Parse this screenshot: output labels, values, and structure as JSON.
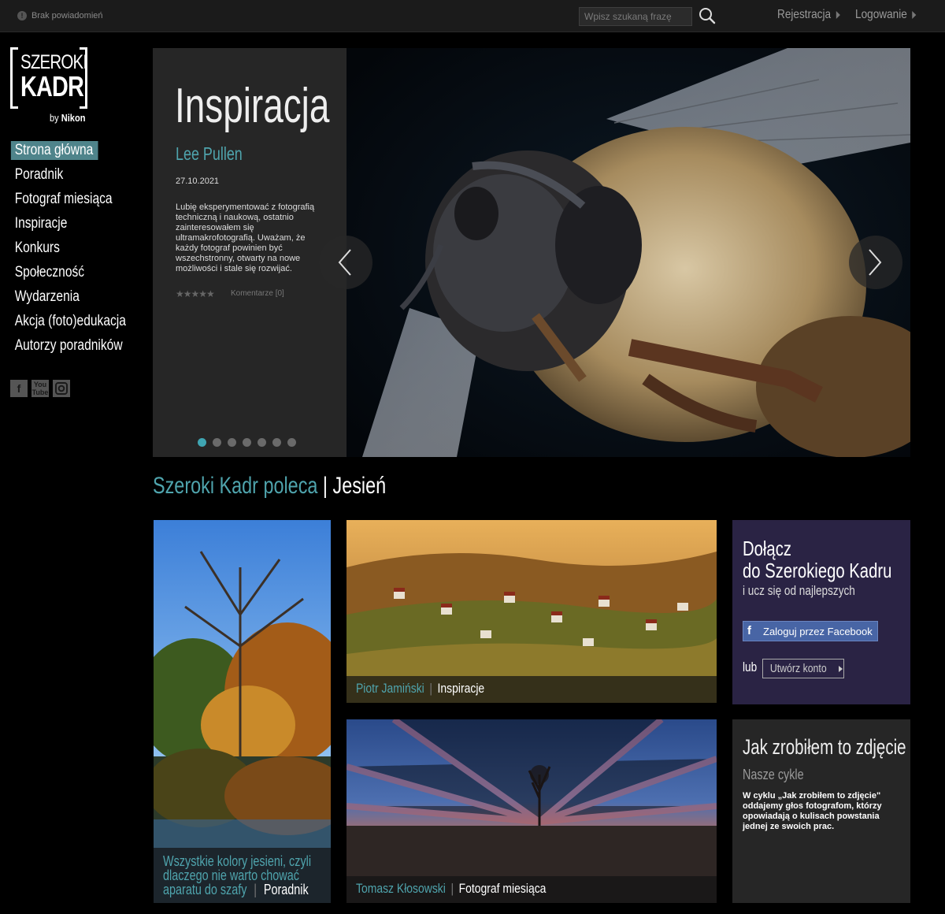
{
  "topbar": {
    "notifications": "Brak powiadomień",
    "search_placeholder": "Wpisz szukaną frazę",
    "register": "Rejestracja",
    "login": "Logowanie"
  },
  "logo": {
    "line1": "SZEROKI",
    "line2": "KADR",
    "by": "by",
    "brand": "Nikon"
  },
  "nav": [
    "Strona główna",
    "Poradnik",
    "Fotograf miesiąca",
    "Inspiracje",
    "Konkurs",
    "Społeczność",
    "Wydarzenia",
    "Akcja (foto)edukacja",
    "Autorzy poradników"
  ],
  "social": [
    "facebook-icon",
    "youtube-icon",
    "instagram-icon"
  ],
  "hero": {
    "title": "Inspiracja",
    "author": "Lee Pullen",
    "date": "27.10.2021",
    "description": "Lubię eksperymentować z fotografią techniczną i naukową, ostatnio zainteresowałem się ultramakrofotografią. Uważam, że każdy fotograf powinien być wszechstronny, otwarty na nowe możliwości i stale się rozwijać.",
    "stars": "★★★★★",
    "comments": "Komentarze [0]",
    "slides_total": 7,
    "active_slide": 1
  },
  "section": {
    "title_a": "Szeroki Kadr poleca",
    "sep": " | ",
    "title_b": "Jesień"
  },
  "tiles": {
    "trees": {
      "text": "Wszystkie kolory jesieni, czyli dlaczego nie warto chować aparatu do szafy",
      "sep": "|",
      "category": "Poradnik"
    },
    "village": {
      "author": "Piotr Jamiński",
      "sep": "|",
      "category": "Inspiracje"
    },
    "sunset": {
      "author": "Tomasz Kłosowski",
      "sep": "|",
      "category": "Fotograf miesiąca"
    }
  },
  "join": {
    "title_l1": "Dołącz",
    "title_l2": "do Szerokiego Kadru",
    "subtitle": "i ucz się od najlepszych",
    "facebook_button": "Zaloguj przez Facebook",
    "or": "lub",
    "create_account": "Utwórz konto"
  },
  "howto": {
    "title": "Jak zrobiłem to zdjęcie",
    "subtitle": "Nasze cykle",
    "description": "W cyklu „Jak zrobiłem to zdjęcie\" oddajemy głos fotografom, którzy opowiadają o kulisach powstania jednej ze swoich prac."
  },
  "colors": {
    "accent": "#4fa4ad",
    "join_bg": "#2a2344",
    "active_nav": "#4f848b"
  }
}
